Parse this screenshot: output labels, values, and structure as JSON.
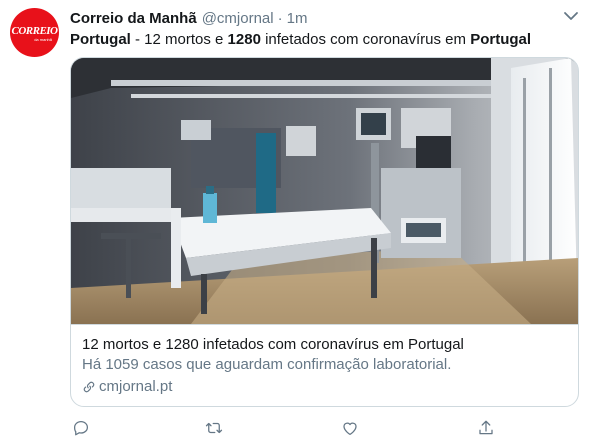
{
  "tweet": {
    "author": {
      "name": "Correio da Manhã",
      "handle": "@cmjornal",
      "avatar_logo": "CORREIO",
      "avatar_sub": "da manhã",
      "avatar_color": "#e8111a"
    },
    "separator": "·",
    "time": "1m",
    "text": {
      "part1": "Portugal",
      "part2": " - 12 mortos e ",
      "part3": "1280",
      "part4": " infetados com coronavírus em ",
      "part5": "Portugal"
    },
    "card": {
      "image_alt": "hospital-icu-room-photo",
      "title": "12 mortos e 1280 infetados com coronavírus em Portugal",
      "description": "Há 1059 casos que aguardam confirmação laboratorial.",
      "domain": "cmjornal.pt"
    },
    "actions": {
      "reply_icon": "reply-icon",
      "retweet_icon": "retweet-icon",
      "like_icon": "heart-icon",
      "share_icon": "share-icon"
    },
    "colors": {
      "text_primary": "#14171a",
      "text_secondary": "#657786",
      "border": "#cfd9de"
    }
  }
}
